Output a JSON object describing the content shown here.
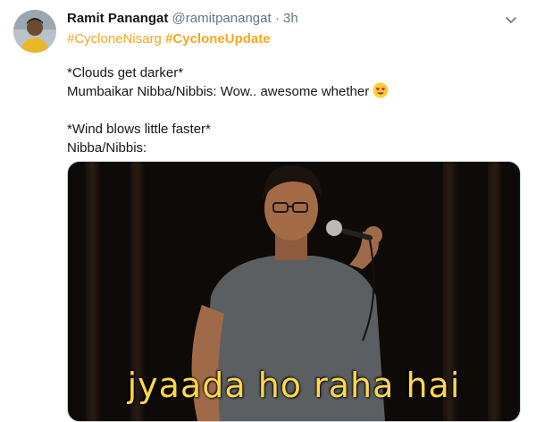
{
  "author": {
    "name": "Ramit Panangat",
    "handle": "@ramitpanangat",
    "separator": "·",
    "time": "3h"
  },
  "hashtags": [
    "#CycloneNisarg",
    "#CycloneUpdate"
  ],
  "tweet": {
    "line1": "*Clouds get darker*",
    "line2": "Mumbaikar Nibba/Nibbis: Wow.. awesome whether",
    "line3": "*Wind blows little faster*",
    "line4": "Nibba/Nibbis:"
  },
  "media": {
    "caption": "jyaada ho raha hai"
  },
  "icons": {
    "menu": "chevron-down-icon",
    "emoji": "heart-eyes-emoji-icon"
  },
  "colors": {
    "hashtag": "#f5a623",
    "secondary_text": "#657786"
  }
}
